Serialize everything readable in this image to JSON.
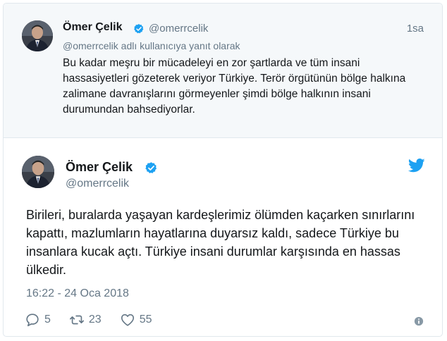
{
  "parent_tweet": {
    "author_name": "Ömer Çelik",
    "handle": "@omerrcelik",
    "time": "1sa",
    "reply_note": "@omerrcelik adlı kullanıcıya yanıt olarak",
    "text": "Bu kadar meşru bir mücadeleyi en zor şartlarda ve tüm insani hassasiyetleri gözeterek veriyor Türkiye. Terör örgütünün bölge halkına zalimane davranışlarını görmeyenler şimdi bölge halkının insani durumundan bahsediyorlar.",
    "verified": true
  },
  "main_tweet": {
    "author_name": "Ömer Çelik",
    "handle": "@omerrcelik",
    "text": "Birileri, buralarda yaşayan kardeşlerimiz ölümden kaçarken sınırlarını kapattı, mazlumların hayatlarına duyarsız kaldı, sadece Türkiye bu insanlara kucak açtı. Türkiye insani durumlar karşısında en hassas ülkedir.",
    "datetime": "16:22 - 24 Oca 2018",
    "verified": true,
    "actions": {
      "replies": "5",
      "retweets": "23",
      "likes": "55"
    }
  },
  "colors": {
    "accent": "#1da1f2",
    "muted": "#657786",
    "text": "#14171a",
    "parent_bg": "#f5f8fa",
    "border": "#e1e8ed"
  },
  "icons": {
    "verified": "verified-badge-icon",
    "brand": "twitter-bird-icon",
    "reply": "reply-icon",
    "retweet": "retweet-icon",
    "like": "heart-icon",
    "info": "info-icon"
  }
}
